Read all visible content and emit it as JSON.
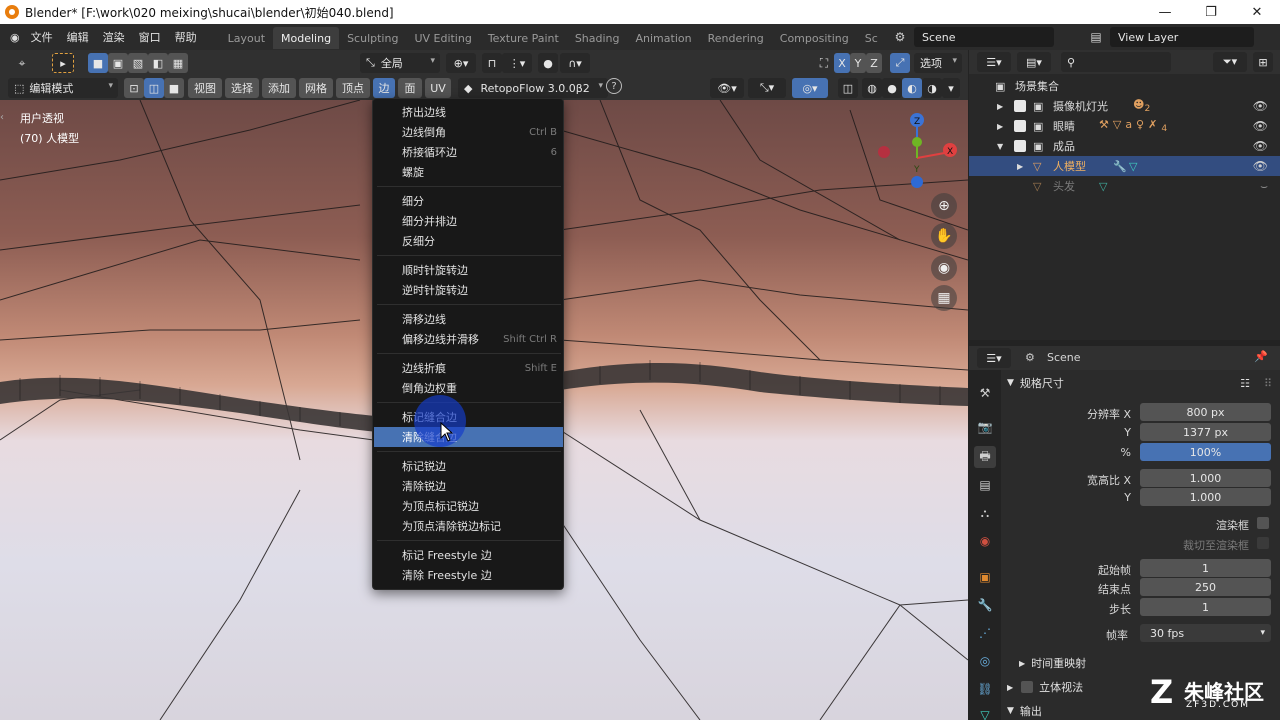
{
  "window": {
    "title": "Blender* [F:\\work\\020 meixing\\shucai\\blender\\初始040.blend]",
    "controls": [
      "—",
      "❐",
      "✕"
    ]
  },
  "topmenu": {
    "items": [
      "文件",
      "编辑",
      "渲染",
      "窗口",
      "帮助"
    ],
    "workspaces": [
      "Layout",
      "Modeling",
      "Sculpting",
      "UV Editing",
      "Texture Paint",
      "Shading",
      "Animation",
      "Rendering",
      "Compositing",
      "Sc"
    ],
    "active_workspace": "Modeling",
    "scene": "Scene",
    "view_layer": "View Layer"
  },
  "viewport_header": {
    "transform_orientation": "全局",
    "options_label": "选项",
    "axes": [
      "X",
      "Y",
      "Z"
    ],
    "mode": "编辑模式",
    "menus": [
      "视图",
      "选择",
      "添加",
      "网格",
      "顶点",
      "边",
      "面",
      "UV"
    ],
    "active_menu": "边",
    "addon": "RetopoFlow 3.0.0β2"
  },
  "viewport": {
    "view_name": "用户透视",
    "object_label": "(70) 人模型",
    "gizmo_axes": [
      "Z",
      "X",
      "Y"
    ]
  },
  "edge_menu": {
    "items": [
      {
        "label": "挤出边线",
        "shortcut": ""
      },
      {
        "label": "边线倒角",
        "shortcut": "Ctrl B"
      },
      {
        "label": "桥接循环边",
        "shortcut": "6"
      },
      {
        "label": "螺旋",
        "shortcut": ""
      },
      {
        "label": "细分",
        "shortcut": ""
      },
      {
        "label": "细分并排边",
        "shortcut": ""
      },
      {
        "label": "反细分",
        "shortcut": ""
      },
      {
        "label": "顺时针旋转边",
        "shortcut": ""
      },
      {
        "label": "逆时针旋转边",
        "shortcut": ""
      },
      {
        "label": "滑移边线",
        "shortcut": ""
      },
      {
        "label": "偏移边线并滑移",
        "shortcut": "Shift Ctrl R"
      },
      {
        "label": "边线折痕",
        "shortcut": "Shift E"
      },
      {
        "label": "倒角边权重",
        "shortcut": ""
      },
      {
        "label": "标记缝合边",
        "shortcut": ""
      },
      {
        "label": "清除缝合边",
        "shortcut": ""
      },
      {
        "label": "标记锐边",
        "shortcut": ""
      },
      {
        "label": "清除锐边",
        "shortcut": ""
      },
      {
        "label": "为顶点标记锐边",
        "shortcut": ""
      },
      {
        "label": "为顶点清除锐边标记",
        "shortcut": ""
      },
      {
        "label": "标记 Freestyle 边",
        "shortcut": ""
      },
      {
        "label": "清除 Freestyle 边",
        "shortcut": ""
      }
    ],
    "highlighted": "清除缝合边"
  },
  "outliner": {
    "root": "场景集合",
    "rows": [
      {
        "label": "摄像机灯光",
        "badge": "2"
      },
      {
        "label": "眼睛",
        "badge": "4"
      },
      {
        "label": "成品",
        "badge": ""
      },
      {
        "label": "人模型",
        "badge": ""
      },
      {
        "label": "头发",
        "badge": ""
      }
    ]
  },
  "properties": {
    "context": "Scene",
    "section_format": "规格尺寸",
    "resolution_x_label": "分辨率 X",
    "resolution_x": "800 px",
    "y_label": "Y",
    "resolution_y": "1377 px",
    "percent_label": "%",
    "percent": "100%",
    "aspect_x_label": "宽高比 X",
    "aspect_x": "1.000",
    "aspect_y": "1.000",
    "render_region": "渲染框",
    "crop_to_region": "裁切至渲染框",
    "frame_start_label": "起始帧",
    "frame_start": "1",
    "frame_end_label": "结束点",
    "frame_end": "250",
    "frame_step_label": "步长",
    "frame_step": "1",
    "frame_rate_label": "帧率",
    "frame_rate": "30 fps",
    "time_remap": "时间重映射",
    "stereoscopy": "立体视法",
    "output": "输出"
  },
  "watermark": {
    "brand": "朱峰社区",
    "url": "ZF3D.COM"
  }
}
